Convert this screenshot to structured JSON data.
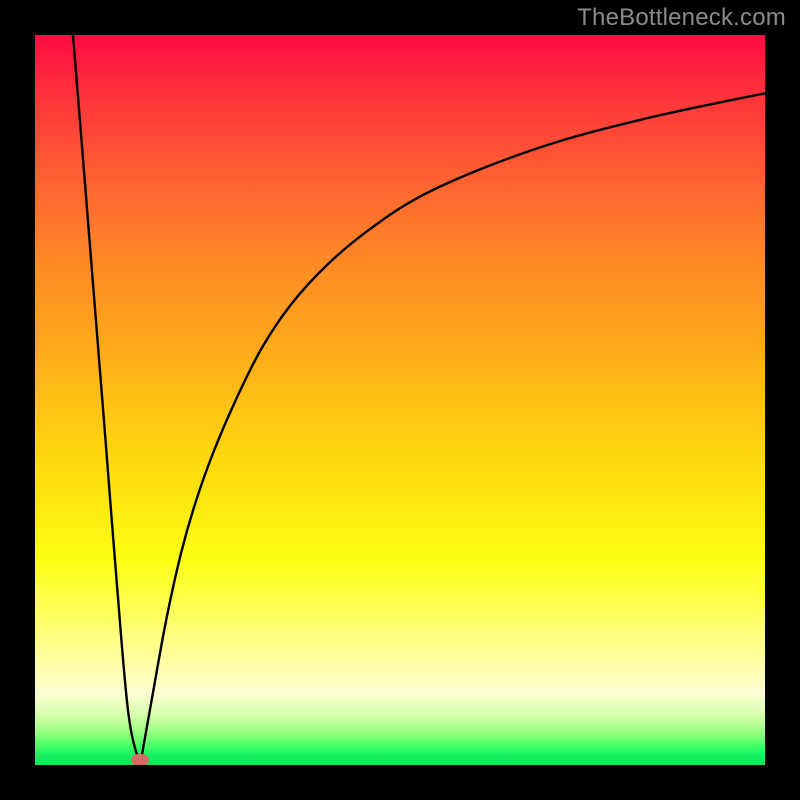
{
  "watermark": "TheBottleneck.com",
  "colors": {
    "frame": "#000000",
    "curve": "#000000",
    "marker": "#d96a61",
    "watermark": "#8b8b8b"
  },
  "chart_data": {
    "type": "line",
    "title": "",
    "xlabel": "",
    "ylabel": "",
    "xlim": [
      0,
      100
    ],
    "ylim": [
      0,
      100
    ],
    "grid": false,
    "legend": null,
    "series": [
      {
        "name": "left-branch",
        "x": [
          5.2,
          6.5,
          8.1,
          9.7,
          11.2,
          12.8,
          14.4
        ],
        "y": [
          100,
          84,
          64,
          44,
          25,
          7,
          0
        ]
      },
      {
        "name": "right-branch",
        "x": [
          14.4,
          16,
          18,
          20,
          22,
          24.5,
          27.5,
          31,
          35,
          40,
          46,
          53,
          62,
          72,
          83,
          94,
          100
        ],
        "y": [
          0,
          9,
          20,
          29,
          36,
          43,
          50,
          57,
          63,
          68.5,
          73.5,
          78,
          82,
          85.5,
          88.4,
          90.8,
          92
        ]
      }
    ],
    "marker": {
      "x": 14.4,
      "y": 0.7
    },
    "background_gradient_stops": [
      {
        "pos": 0.0,
        "color": "#ff0b42"
      },
      {
        "pos": 0.1,
        "color": "#ff3b3a"
      },
      {
        "pos": 0.22,
        "color": "#ff6a30"
      },
      {
        "pos": 0.32,
        "color": "#ff8c24"
      },
      {
        "pos": 0.44,
        "color": "#ffad1a"
      },
      {
        "pos": 0.55,
        "color": "#ffd010"
      },
      {
        "pos": 0.64,
        "color": "#fce80e"
      },
      {
        "pos": 0.72,
        "color": "#fdff14"
      },
      {
        "pos": 0.8,
        "color": "#feff66"
      },
      {
        "pos": 0.865,
        "color": "#ffffab"
      },
      {
        "pos": 0.9,
        "color": "#fcffd2"
      },
      {
        "pos": 0.925,
        "color": "#e1ffb6"
      },
      {
        "pos": 0.945,
        "color": "#b6ff94"
      },
      {
        "pos": 0.962,
        "color": "#7bff74"
      },
      {
        "pos": 0.976,
        "color": "#3aff66"
      },
      {
        "pos": 0.986,
        "color": "#17f060"
      },
      {
        "pos": 1.0,
        "color": "#14e45a"
      }
    ]
  }
}
